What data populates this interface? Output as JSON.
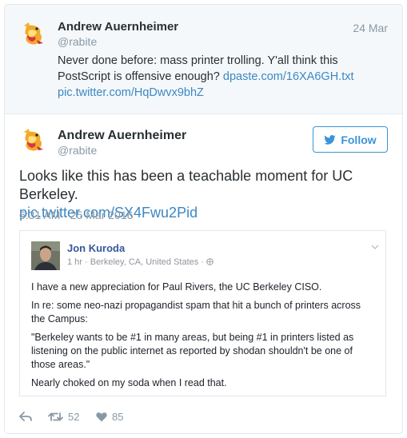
{
  "parent_tweet": {
    "name": "Andrew Auernheimer",
    "handle": "@rabite",
    "date": "24 Mar",
    "text_before": "Never done before: mass printer trolling. Y'all think this PostScript is offensive enough? ",
    "link1": "dpaste.com/16XA6GH.txt",
    "link2": "pic.twitter.com/HqDwvx9bhZ"
  },
  "main_tweet": {
    "name": "Andrew Auernheimer",
    "handle": "@rabite",
    "follow_label": "Follow",
    "text": "Looks like this has been a teachable moment for UC Berkeley.",
    "link": "pic.twitter.com/SX4Fwu2Pid",
    "timestamp": "6:31 AM - 25 Mar 2016"
  },
  "fb_post": {
    "name": "Jon Kuroda",
    "meta": "1 hr · Berkeley, CA, United States · ",
    "p1": "I have a new appreciation for Paul Rivers, the UC Berkeley CISO.",
    "p2": "In re: some neo-nazi propagandist spam that hit a bunch of printers across the Campus:",
    "p3": "\"Berkeley wants to be #1 in many areas, but being #1 in printers listed as listening on the public internet as reported by shodan shouldn't be one of those areas.\"",
    "p4": "Nearly choked on my soda when I read that."
  },
  "actions": {
    "retweets": "52",
    "likes": "85"
  },
  "colors": {
    "link": "#3b88c3",
    "follow": "#3b94d9",
    "muted": "#8899a6",
    "fb_name": "#365899"
  }
}
